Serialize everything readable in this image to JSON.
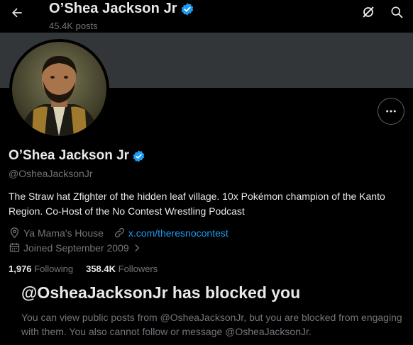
{
  "header": {
    "title": "O’Shea Jackson Jr",
    "posts_count": "45.4K posts",
    "back_icon": "back-arrow-icon",
    "action_icons": [
      "grok-icon",
      "search-icon"
    ]
  },
  "profile": {
    "display_name": "O’Shea Jackson Jr",
    "handle": "@OsheaJacksonJr",
    "bio": "The Straw hat Zfighter of the hidden leaf village. 10x Pokémon champion of the Kanto Region. Co-Host of the No Contest Wrestling Podcast",
    "location": "Ya Mama's House",
    "website": "x.com/theresnocontest",
    "joined": "Joined September 2009",
    "following_count": "1,976",
    "following_label": "Following",
    "followers_count": "358.4K",
    "followers_label": "Followers"
  },
  "blocked": {
    "title": "@OsheaJacksonJr has blocked you",
    "description": "You can view public posts from @OsheaJacksonJr, but you are blocked from engaging with them. You also cannot follow or message @OsheaJacksonJr."
  },
  "colors": {
    "background": "#000000",
    "banner": "#333639",
    "accent": "#1d9bf0",
    "muted": "#71767b",
    "text": "#e7e9ea"
  }
}
